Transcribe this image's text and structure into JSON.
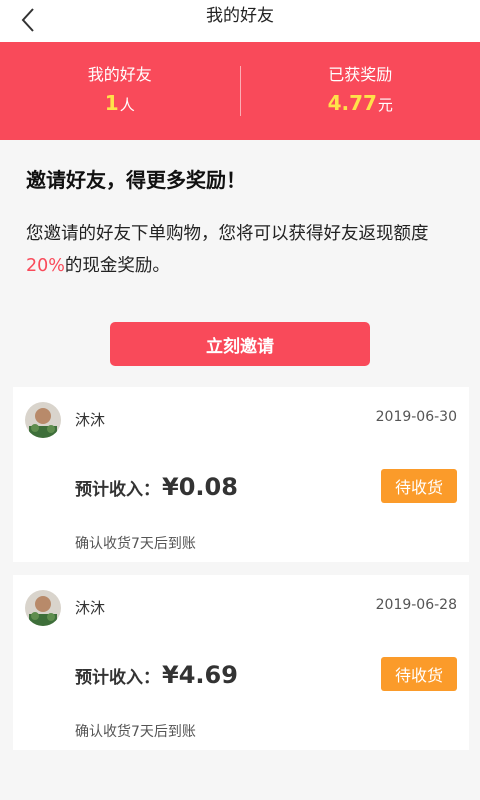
{
  "header": {
    "title": "我的好友"
  },
  "stats": {
    "friends": {
      "label": "我的好友",
      "value": "1",
      "unit": "人"
    },
    "rewards": {
      "label": "已获奖励",
      "value": "4.77",
      "unit": "元"
    }
  },
  "intro": {
    "headline": "邀请好友，得更多奖励！",
    "desc_before": "您邀请的好友下单购物，您将可以获得好友返现额度",
    "desc_percent": "20%",
    "desc_after": "的现金奖励。"
  },
  "invite_button": "立刻邀请",
  "colors": {
    "primary": "#f94a5a",
    "status": "#fb9b2a",
    "highlight": "#ffe14a"
  },
  "orders": [
    {
      "name": "沐沐",
      "date": "2019-06-30",
      "income_label": "预计收入：",
      "amount": "¥0.08",
      "status": "待收货",
      "note": "确认收货7天后到账",
      "avatar_icon": "user-avatar"
    },
    {
      "name": "沐沐",
      "date": "2019-06-28",
      "income_label": "预计收入：",
      "amount": "¥4.69",
      "status": "待收货",
      "note": "确认收货7天后到账",
      "avatar_icon": "user-avatar"
    }
  ]
}
